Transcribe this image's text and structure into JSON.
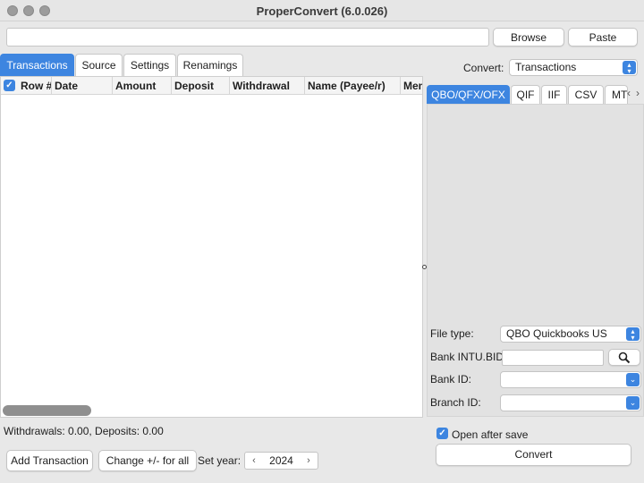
{
  "window": {
    "title": "ProperConvert (6.0.026)"
  },
  "toolbar": {
    "path_value": "",
    "browse_label": "Browse",
    "paste_label": "Paste"
  },
  "left_tabs": [
    {
      "label": "Transactions",
      "active": true
    },
    {
      "label": "Source",
      "active": false
    },
    {
      "label": "Settings",
      "active": false
    },
    {
      "label": "Renamings",
      "active": false
    }
  ],
  "table": {
    "select_all_checked": true,
    "columns": [
      "Row #",
      "Date",
      "Amount",
      "Deposit",
      "Withdrawal",
      "Name (Payee/r)",
      "Mem"
    ],
    "rows": []
  },
  "summary": {
    "totals_text": "Withdrawals: 0.00, Deposits: 0.00"
  },
  "actions": {
    "add_transaction_label": "Add Transaction",
    "change_sign_label": "Change +/- for all",
    "set_year_label": "Set year:",
    "year_value": "2024"
  },
  "convert_section": {
    "convert_label": "Convert:",
    "convert_value": "Transactions",
    "format_tabs": [
      {
        "label": "QBO/QFX/OFX",
        "active": true
      },
      {
        "label": "QIF",
        "active": false
      },
      {
        "label": "IIF",
        "active": false
      },
      {
        "label": "CSV",
        "active": false
      },
      {
        "label": "MT",
        "active": false
      }
    ],
    "file_type_label": "File type:",
    "file_type_value": "QBO Quickbooks US",
    "bank_intu_bid_label": "Bank INTU.BID:",
    "bank_intu_bid_value": "",
    "bank_id_label": "Bank ID:",
    "bank_id_value": "",
    "branch_id_label": "Branch ID:",
    "branch_id_value": "",
    "open_after_save_label": "Open after save",
    "open_after_save_checked": true,
    "convert_button_label": "Convert"
  },
  "colors": {
    "accent": "#3d85e0",
    "window_bg": "#e8e8e8",
    "panel_bg": "#e2e2e2"
  }
}
